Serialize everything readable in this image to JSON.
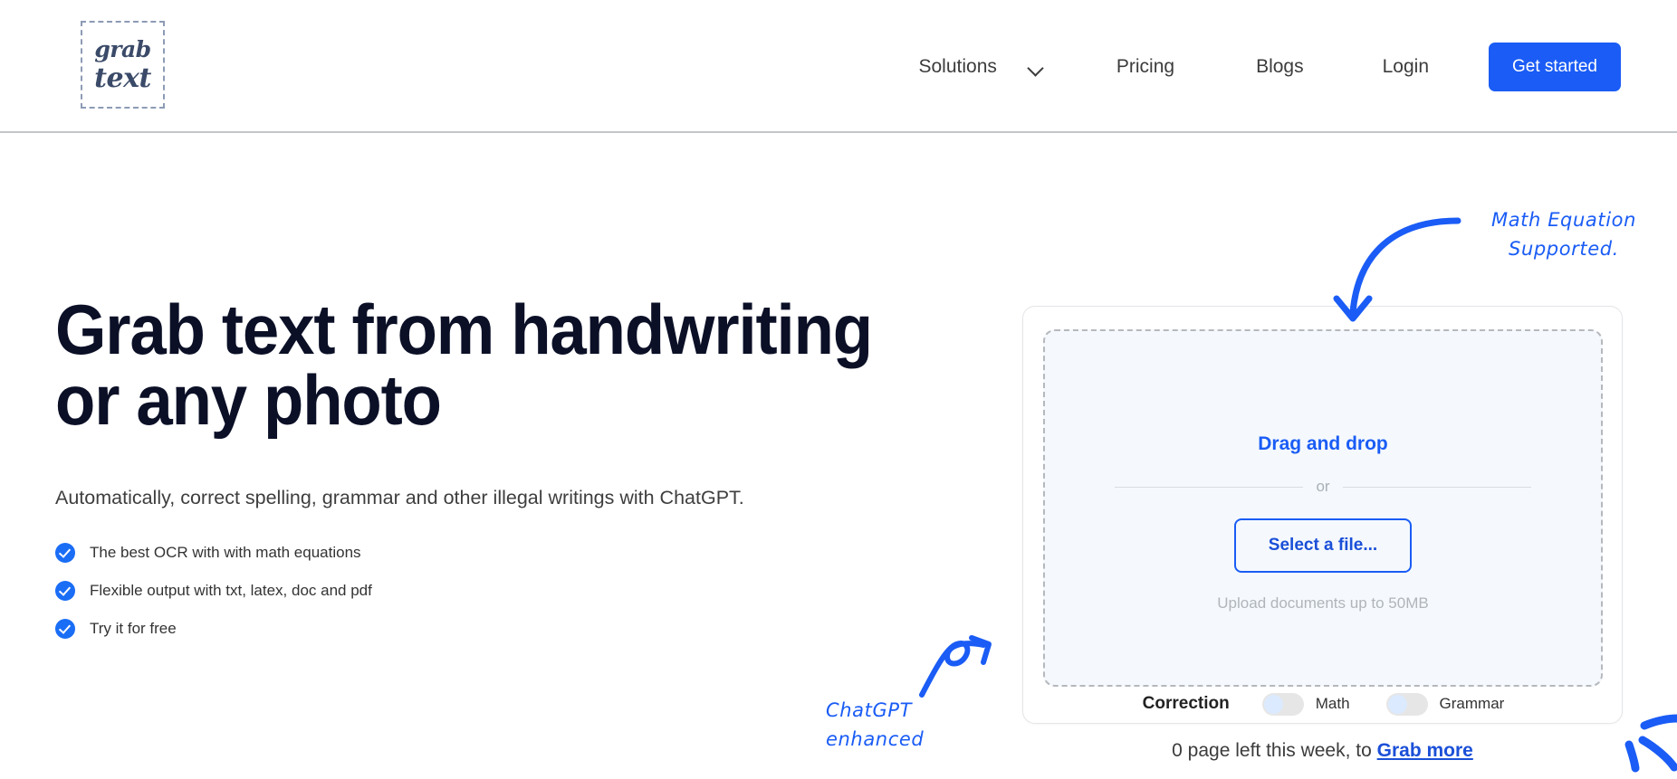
{
  "header": {
    "logo": {
      "line1": "grab",
      "line2": "text",
      "icon": "dashed-box-logo"
    },
    "nav": [
      {
        "label": "Solutions",
        "has_chevron": true,
        "icon": "chevron-down-icon"
      },
      {
        "label": "Pricing",
        "has_chevron": false
      },
      {
        "label": "Blogs",
        "has_chevron": false
      },
      {
        "label": "Login",
        "has_chevron": false
      }
    ],
    "cta": {
      "label": "Get started",
      "color": "#1a5cf5"
    }
  },
  "hero": {
    "heading": "Grab text from handwriting or any photo",
    "subheading": "Automatically, correct spelling, grammar and other illegal writings with ChatGPT.",
    "bullets": [
      {
        "label": "The best OCR with with math equations",
        "icon": "check-circle-icon"
      },
      {
        "label": "Flexible output with txt, latex, doc and pdf",
        "icon": "check-circle-icon"
      },
      {
        "label": "Try it for free",
        "icon": "check-circle-icon"
      }
    ]
  },
  "uploader": {
    "drag_and_drop": "Drag and drop",
    "or": "or",
    "select_file": "Select a file...",
    "upload_hint": "Upload documents up to 50MB",
    "correction": {
      "label": "Correction",
      "toggles": [
        {
          "label": "Math",
          "state": "off"
        },
        {
          "label": "Grammar",
          "state": "off"
        }
      ]
    }
  },
  "footer": {
    "quota_text": "0 page left this week, to",
    "link_label": "Grab more"
  },
  "annotations": [
    {
      "id": "math",
      "line1": "Math Equation",
      "line2": "Supported.",
      "icon": "curved-arrow-down-icon",
      "color": "#1a5cf5"
    },
    {
      "id": "chatgpt",
      "line1": "ChatGPT",
      "line2": "enhanced",
      "icon": "looped-arrow-up-right-icon",
      "color": "#1a5cf5"
    },
    {
      "id": "sparkle",
      "line1": "",
      "line2": "",
      "icon": "sparkle-burst-icon",
      "color": "#1a5cf5"
    }
  ]
}
